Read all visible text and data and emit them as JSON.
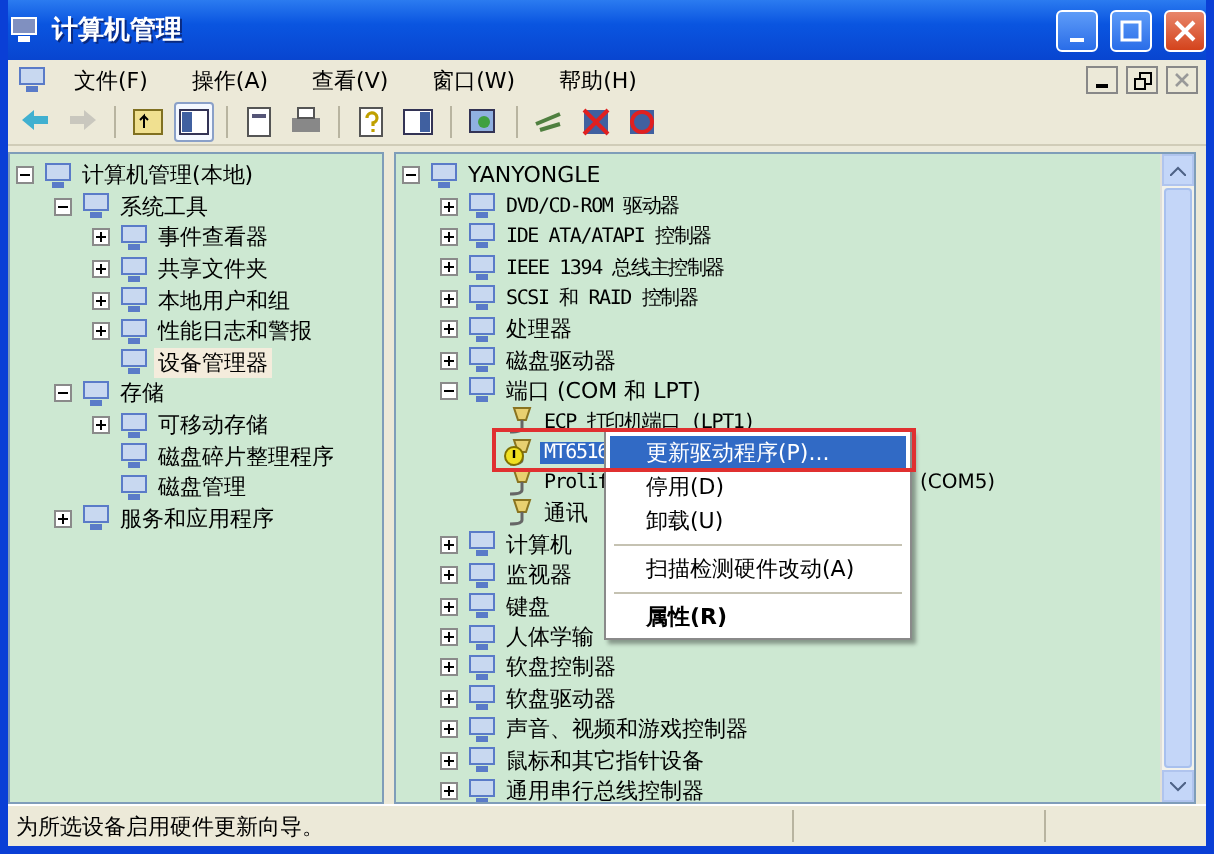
{
  "window": {
    "title": "计算机管理"
  },
  "menu": [
    {
      "label": "文件(F)"
    },
    {
      "label": "操作(A)"
    },
    {
      "label": "查看(V)"
    },
    {
      "label": "窗口(W)"
    },
    {
      "label": "帮助(H)"
    }
  ],
  "toolbar": [
    {
      "kind": "back",
      "disabled": false,
      "pressed": false
    },
    {
      "kind": "forward",
      "disabled": true,
      "pressed": false
    },
    {
      "kind": "sep"
    },
    {
      "kind": "up",
      "disabled": false,
      "pressed": false
    },
    {
      "kind": "tree",
      "disabled": false,
      "pressed": true
    },
    {
      "kind": "sep"
    },
    {
      "kind": "props",
      "disabled": false,
      "pressed": false
    },
    {
      "kind": "print",
      "disabled": false,
      "pressed": false
    },
    {
      "kind": "sep"
    },
    {
      "kind": "help",
      "disabled": false,
      "pressed": false
    },
    {
      "kind": "panel",
      "disabled": false,
      "pressed": false
    },
    {
      "kind": "sep"
    },
    {
      "kind": "scan",
      "disabled": false,
      "pressed": false
    },
    {
      "kind": "sep"
    },
    {
      "kind": "update",
      "disabled": false,
      "pressed": false
    },
    {
      "kind": "uninstall",
      "disabled": false,
      "pressed": false
    },
    {
      "kind": "disable",
      "disabled": false,
      "pressed": false
    }
  ],
  "left_tree": [
    {
      "label": "计算机管理(本地)",
      "selected": false,
      "expanded": true,
      "children": [
        {
          "label": "系统工具",
          "selected": false,
          "expanded": true,
          "children": [
            {
              "label": "事件查看器",
              "selected": false,
              "expanded": false
            },
            {
              "label": "共享文件夹",
              "selected": false,
              "expanded": false
            },
            {
              "label": "本地用户和组",
              "selected": false,
              "expanded": false
            },
            {
              "label": "性能日志和警报",
              "selected": false,
              "expanded": false
            },
            {
              "label": "设备管理器",
              "selected": true
            }
          ]
        },
        {
          "label": "存储",
          "selected": false,
          "expanded": true,
          "children": [
            {
              "label": "可移动存储",
              "selected": false,
              "expanded": false
            },
            {
              "label": "磁盘碎片整理程序",
              "selected": false
            },
            {
              "label": "磁盘管理",
              "selected": false
            }
          ]
        },
        {
          "label": "服务和应用程序",
          "selected": false,
          "expanded": false
        }
      ]
    }
  ],
  "right_tree": [
    {
      "label": "YANYONGLE",
      "selected": false,
      "expanded": true,
      "children": [
        {
          "label": "DVD/CD-ROM 驱动器",
          "selected": false,
          "expanded": false
        },
        {
          "label": "IDE ATA/ATAPI 控制器",
          "selected": false,
          "expanded": false
        },
        {
          "label": "IEEE 1394 总线主控制器",
          "selected": false,
          "expanded": false
        },
        {
          "label": "SCSI 和 RAID 控制器",
          "selected": false,
          "expanded": false
        },
        {
          "label": "处理器",
          "selected": false,
          "expanded": false
        },
        {
          "label": "磁盘驱动器",
          "selected": false,
          "expanded": false
        },
        {
          "label": "端口 (COM 和 LPT)",
          "selected": false,
          "expanded": true,
          "children": [
            {
              "label": "ECP 打印机端口 (LPT1)",
              "selected": false,
              "warning": false
            },
            {
              "label": "MT6516",
              "selected": true,
              "warning": true
            },
            {
              "label": "Prolif",
              "selected": false,
              "warning": false,
              "suffix": "(COM5)"
            },
            {
              "label": "通讯",
              "selected": false,
              "warning": false
            }
          ]
        },
        {
          "label": "计算机",
          "selected": false,
          "expanded": false
        },
        {
          "label": "监视器",
          "selected": false,
          "expanded": false
        },
        {
          "label": "键盘",
          "selected": false,
          "expanded": false
        },
        {
          "label": "人体学输",
          "selected": false,
          "expanded": false
        },
        {
          "label": "软盘控制器",
          "selected": false,
          "expanded": false
        },
        {
          "label": "软盘驱动器",
          "selected": false,
          "expanded": false
        },
        {
          "label": "声音、视频和游戏控制器",
          "selected": false,
          "expanded": false
        },
        {
          "label": "鼠标和其它指针设备",
          "selected": false,
          "expanded": false
        },
        {
          "label": "通用串行总线控制器",
          "selected": false,
          "expanded": false
        }
      ]
    }
  ],
  "context_menu": [
    {
      "kind": "item",
      "label": "更新驱动程序(P)...",
      "selected": true,
      "bold": false
    },
    {
      "kind": "item",
      "label": "停用(D)",
      "selected": false,
      "bold": false
    },
    {
      "kind": "item",
      "label": "卸载(U)",
      "selected": false,
      "bold": false
    },
    {
      "kind": "separator"
    },
    {
      "kind": "item",
      "label": "扫描检测硬件改动(A)",
      "selected": false,
      "bold": false
    },
    {
      "kind": "separator"
    },
    {
      "kind": "item",
      "label": "属性(R)",
      "selected": false,
      "bold": true
    }
  ],
  "status_bar": {
    "text": "为所选设备启用硬件更新向导。"
  }
}
